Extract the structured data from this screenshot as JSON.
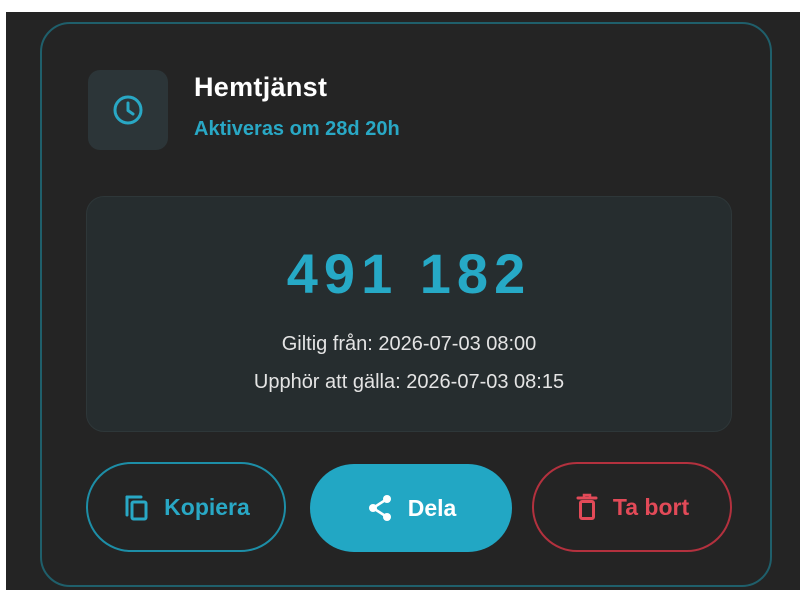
{
  "card": {
    "icon": "clock-icon",
    "title": "Hemtjänst",
    "status": "Aktiveras om 28d 20h"
  },
  "code_panel": {
    "code": "491 182",
    "valid_from": "Giltig från: 2026-07-03 08:00",
    "valid_to": "Upphör att gälla: 2026-07-03 08:15"
  },
  "actions": {
    "copy_label": "Kopiera",
    "copy_icon": "copy-icon",
    "share_label": "Dela",
    "share_icon": "share-icon",
    "delete_label": "Ta bort",
    "delete_icon": "trash-icon"
  },
  "colors": {
    "background": "#242424",
    "card_border": "#1f5f6b",
    "accent": "#22a7c4",
    "danger": "#e24a58",
    "panel": "#262d2f"
  }
}
